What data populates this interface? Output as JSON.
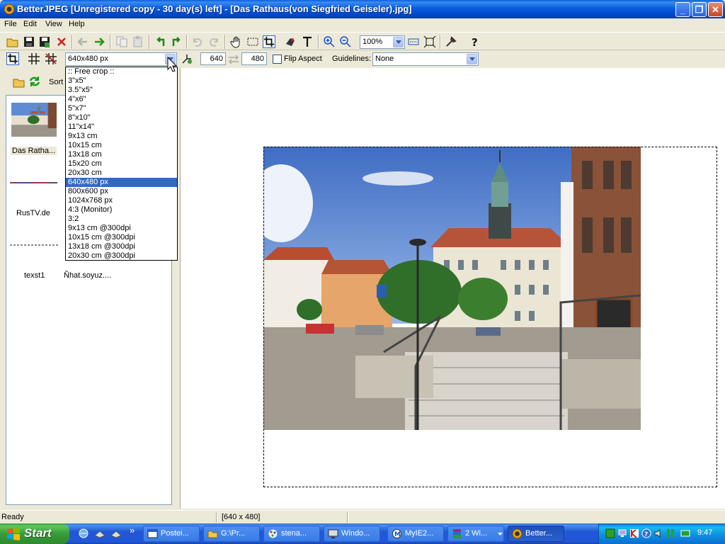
{
  "window": {
    "title": "BetterJPEG [Unregistered copy - 30 day(s) left] - [Das Rathaus(von Siegfried Geiseler).jpg]",
    "minimize": "_",
    "restore": "❐",
    "close": "✕"
  },
  "menu": [
    "File",
    "Edit",
    "View",
    "Help"
  ],
  "toolbar": {
    "zoom_value": "100%",
    "icons": [
      "open-folder-icon",
      "save-icon",
      "save-as-icon",
      "close-file-icon",
      "back-arrow-icon",
      "forward-arrow-icon",
      "copy-icon",
      "paste-icon",
      "rotate-left-icon",
      "rotate-right-icon",
      "undo-icon",
      "redo-icon",
      "hand-icon",
      "selection-icon",
      "crop-icon",
      "red-eye-icon",
      "text-icon",
      "zoom-in-icon",
      "zoom-out-icon",
      "fit-icon",
      "actual-size-icon",
      "tools-icon",
      "help-icon"
    ]
  },
  "crop_bar": {
    "preset_value": "640x480 px",
    "width_value": "640",
    "height_value": "480",
    "flip_aspect_label": "Flip Aspect",
    "flip_aspect_checked": false,
    "guidelines_label": "Guidelines:",
    "guidelines_value": "None"
  },
  "crop_presets": [
    ":: Free crop ::",
    "3\"x5\"",
    "3.5\"x5\"",
    "4\"x6\"",
    "5\"x7\"",
    "8\"x10\"",
    "11\"x14\"",
    "9x13 cm",
    "10x15 cm",
    "13x18 cm",
    "15x20 cm",
    "20x30 cm",
    "640x480 px",
    "800x600 px",
    "1024x768 px",
    "4:3 (Monitor)",
    "3:2",
    "9x13 cm @300dpi",
    "10x15 cm @300dpi",
    "13x18 cm @300dpi",
    "20x30 cm @300dpi"
  ],
  "crop_selected_index": 12,
  "browser": {
    "sort_label": "Sort",
    "items": [
      "Das Ratha...",
      "RusTV.de",
      "texst1",
      "Ñhat.soyuz...."
    ]
  },
  "status": {
    "left": "Ready",
    "size": "[640 x 480]"
  },
  "taskbar": {
    "start_label": "Start",
    "chevron": "»",
    "buttons": [
      "Postei...",
      "G:\\Pr...",
      "stena...",
      "Windo...",
      "MyIE2...",
      "2 Wi...",
      "Better..."
    ],
    "active_index": 6,
    "clock": "9:47"
  },
  "colors": {
    "title_bar": "#0a5ce0",
    "selection": "#316ac5",
    "taskbar": "#2157d7",
    "start_green": "#3c9a3c"
  }
}
